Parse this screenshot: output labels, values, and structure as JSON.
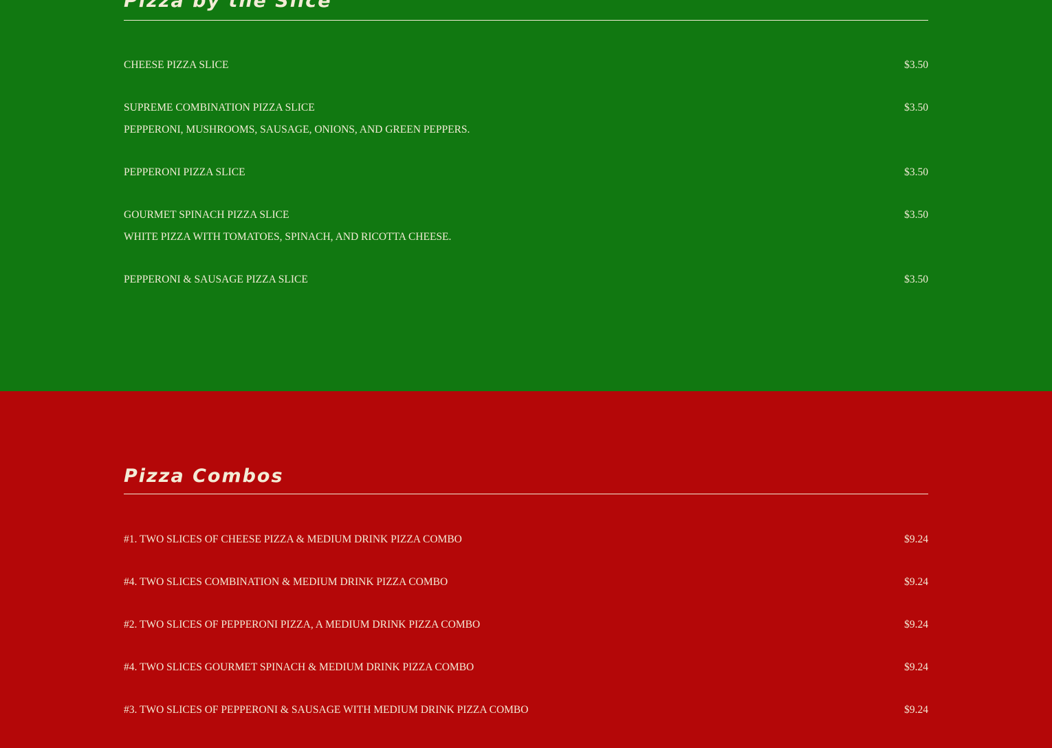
{
  "colors": {
    "green_section_bg": "#117811",
    "red_section_bg": "#b40708",
    "text": "#f3ecd6"
  },
  "slice_section": {
    "title": "Pizza by the Slice",
    "items": [
      {
        "name": "CHEESE PIZZA SLICE",
        "price": "$3.50",
        "description": ""
      },
      {
        "name": "SUPREME COMBINATION PIZZA SLICE",
        "price": "$3.50",
        "description": "PEPPERONI, MUSHROOMS, SAUSAGE, ONIONS, AND GREEN PEPPERS."
      },
      {
        "name": "PEPPERONI PIZZA SLICE",
        "price": "$3.50",
        "description": ""
      },
      {
        "name": "GOURMET SPINACH PIZZA SLICE",
        "price": "$3.50",
        "description": "WHITE PIZZA WITH TOMATOES, SPINACH, AND RICOTTA CHEESE."
      },
      {
        "name": "PEPPERONI & SAUSAGE PIZZA SLICE",
        "price": "$3.50",
        "description": ""
      }
    ]
  },
  "combo_section": {
    "title": "Pizza Combos",
    "items": [
      {
        "name": "#1. TWO SLICES OF CHEESE PIZZA & MEDIUM DRINK PIZZA COMBO",
        "price": "$9.24"
      },
      {
        "name": "#4. TWO SLICES COMBINATION & MEDIUM DRINK PIZZA COMBO",
        "price": "$9.24"
      },
      {
        "name": "#2. TWO SLICES OF PEPPERONI PIZZA, A MEDIUM DRINK PIZZA COMBO",
        "price": "$9.24"
      },
      {
        "name": "#4. TWO SLICES GOURMET SPINACH & MEDIUM DRINK PIZZA COMBO",
        "price": "$9.24"
      },
      {
        "name": "#3. TWO SLICES OF PEPPERONI & SAUSAGE WITH MEDIUM DRINK PIZZA COMBO",
        "price": "$9.24"
      }
    ]
  }
}
